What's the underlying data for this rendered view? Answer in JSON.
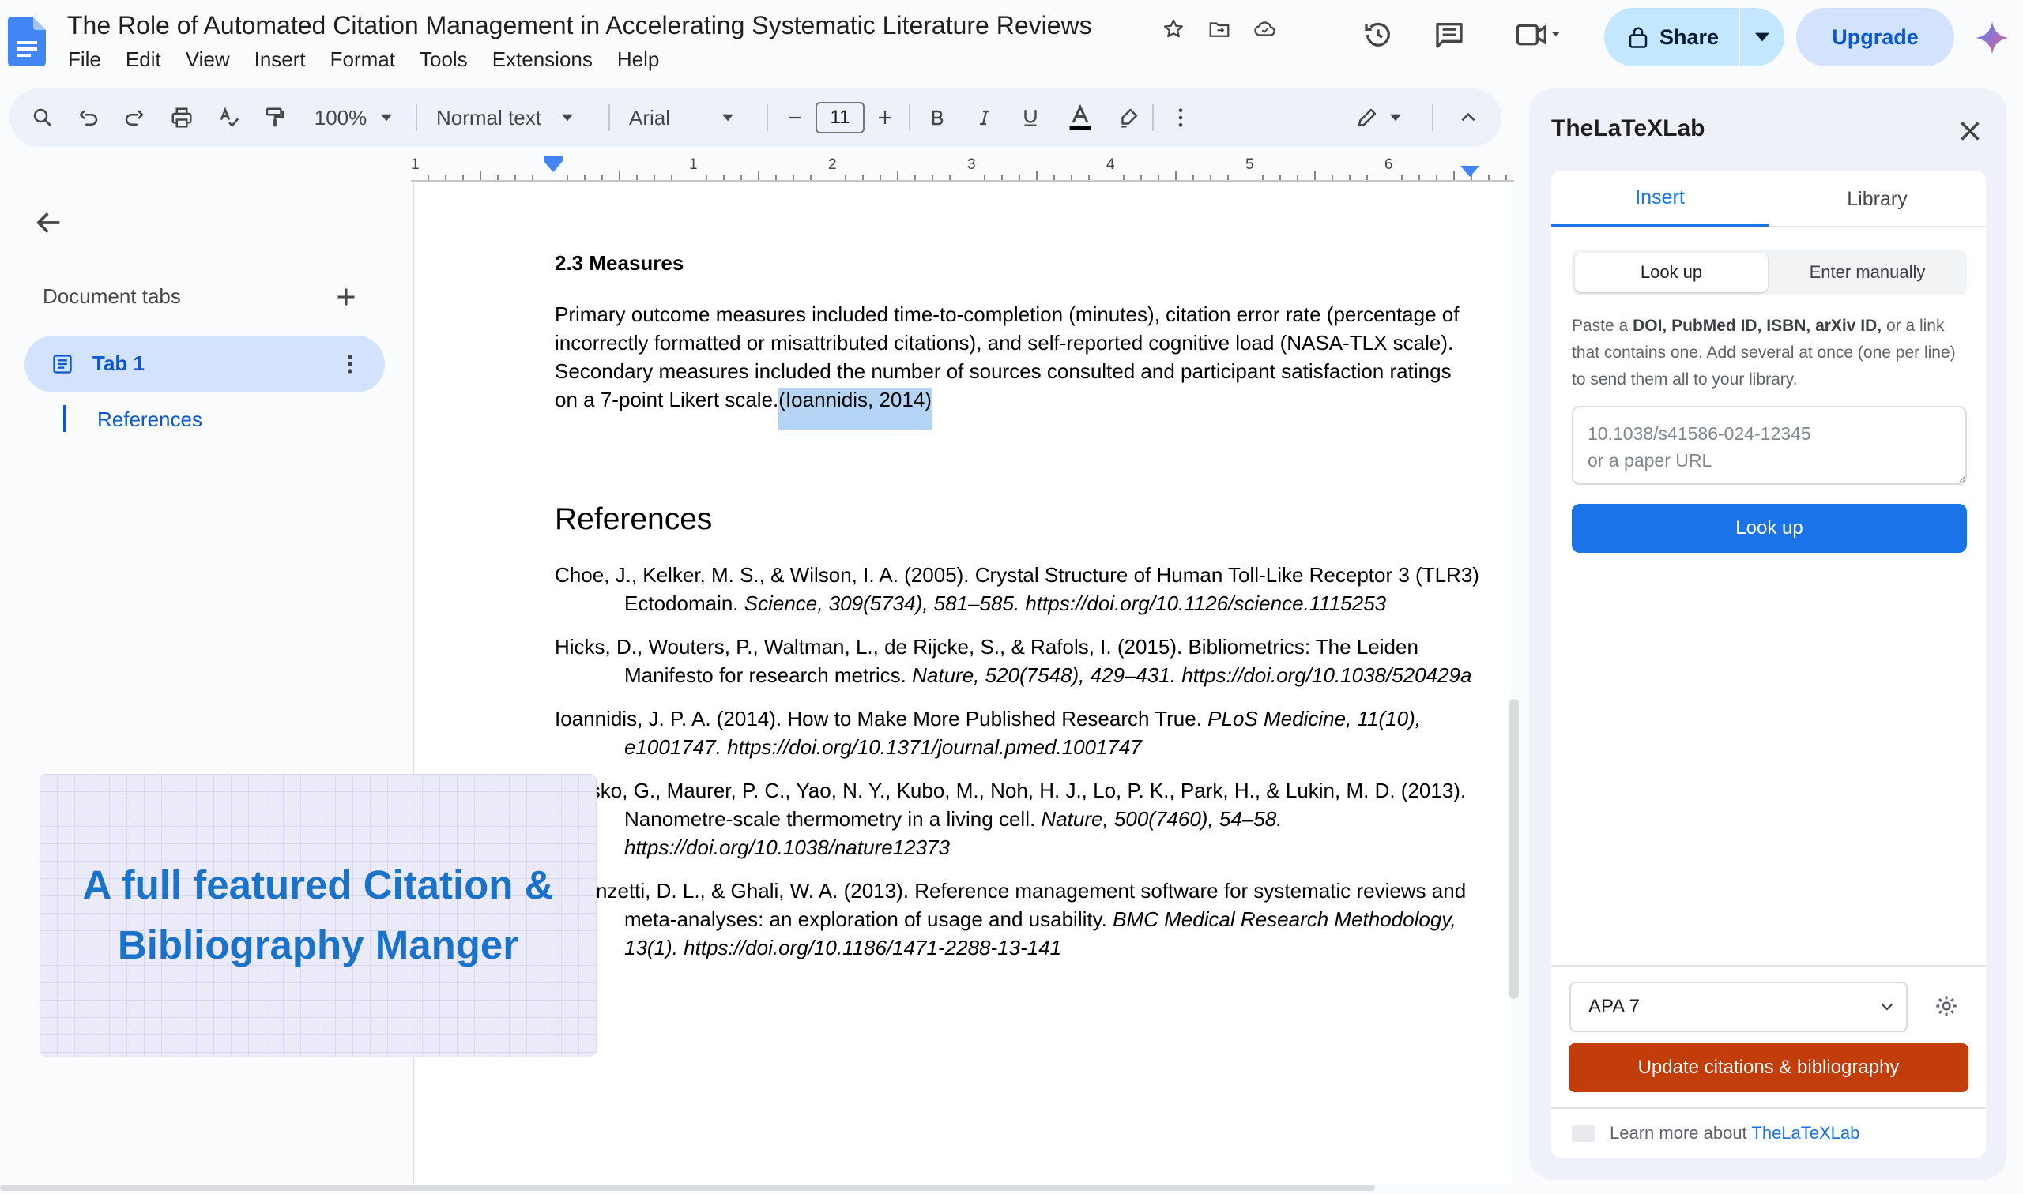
{
  "app": {
    "title": "The Role of Automated Citation Management in Accelerating Systematic Literature Reviews",
    "menu": [
      "File",
      "Edit",
      "View",
      "Insert",
      "Format",
      "Tools",
      "Extensions",
      "Help"
    ],
    "share_label": "Share",
    "upgrade_label": "Upgrade",
    "accent_color": "#1a73e8"
  },
  "toolbar": {
    "zoom": "100%",
    "style": "Normal text",
    "font": "Arial",
    "font_size": "11"
  },
  "ruler": {
    "labels": [
      "1",
      "1",
      "2",
      "3",
      "4",
      "5",
      "6"
    ]
  },
  "left_panel": {
    "heading": "Document tabs",
    "tab_label": "Tab 1",
    "outline_item": "References"
  },
  "document": {
    "section_heading": "2.3 Measures",
    "paragraph": "Primary outcome measures included time-to-completion (minutes), citation error rate (percentage of incorrectly formatted or misattributed citations), and self-reported cognitive load (NASA-TLX scale). Secondary measures included the number of sources consulted and participant satisfaction ratings on a 7-point Likert scale.",
    "citation": "(Ioannidis, 2014)",
    "references_heading": "References",
    "references": [
      {
        "plain": "Choe, J., Kelker, M. S., & Wilson, I. A. (2005). Crystal Structure of Human Toll-Like Receptor 3 (TLR3) Ectodomain. ",
        "italic": "Science, 309(5734), 581–585. https://doi.org/10.1126/science.1115253"
      },
      {
        "plain": "Hicks, D., Wouters, P., Waltman, L., de Rijcke, S., & Rafols, I. (2015). Bibliometrics: The Leiden Manifesto for research metrics. ",
        "italic": "Nature, 520(7548), 429–431. https://doi.org/10.1038/520429a"
      },
      {
        "plain": "Ioannidis, J. P. A. (2014). How to Make More Published Research True. ",
        "italic": "PLoS Medicine, 11(10), e1001747. https://doi.org/10.1371/journal.pmed.1001747"
      },
      {
        "plain": "Kucsko, G., Maurer, P. C., Yao, N. Y., Kubo, M., Noh, H. J., Lo, P. K., Park, H., & Lukin, M. D. (2013). Nanometre-scale thermometry in a living cell. ",
        "italic": "Nature, 500(7460), 54–58. https://doi.org/10.1038/nature12373"
      },
      {
        "plain": "Lorenzetti, D. L., & Ghali, W. A. (2013). Reference management software for systematic reviews and meta-analyses: an exploration of usage and usability. ",
        "italic": "BMC Medical Research Methodology, 13(1). https://doi.org/10.1186/1471-2288-13-141"
      }
    ]
  },
  "promo": {
    "text": "A full featured Citation & Bibliography Manger"
  },
  "side_panel": {
    "title": "TheLaTeXLab",
    "tabs": [
      "Insert",
      "Library"
    ],
    "modes": [
      "Look up",
      "Enter manually"
    ],
    "instructions_prefix": "Paste a ",
    "instructions_ids": "DOI, PubMed ID, ISBN, arXiv ID,",
    "instructions_suffix": " or a link that contains one. Add several at once (one per line) to send them all to your library.",
    "input_placeholder": "10.1038/s41586-024-12345\nor a paper URL",
    "lookup_label": "Look up",
    "citation_style": "APA 7",
    "update_label": "Update citations & bibliography",
    "learn_prefix": "Learn more about",
    "learn_link": "TheLaTeXLab",
    "update_color": "#c23d0a"
  }
}
